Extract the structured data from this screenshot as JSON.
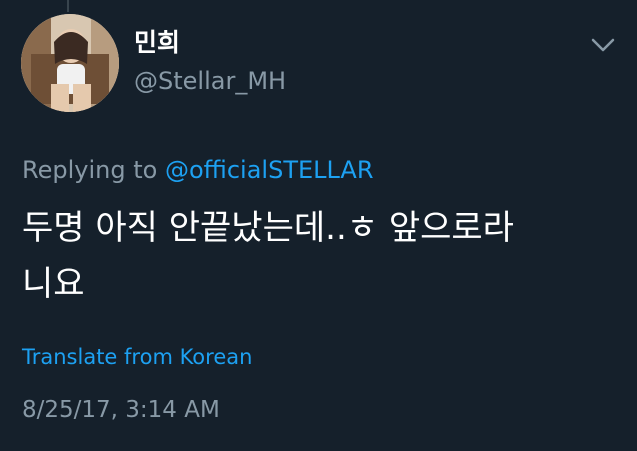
{
  "tweet": {
    "display_name": "민희",
    "handle": "@Stellar_MH",
    "replying_prefix": "Replying to",
    "replying_to": "@officialSTELLAR",
    "text_line1": "두명 아직 안끝났는데..ㅎ 앞으로라",
    "text_line2": "니요",
    "translate_label": "Translate from Korean",
    "timestamp": "8/25/17, 3:14 AM"
  },
  "icons": {
    "menu": "chevron-down-icon",
    "avatar": "profile-photo"
  },
  "colors": {
    "background": "#15202b",
    "accent": "#1da1f2",
    "secondary_text": "#8899a6",
    "primary_text": "#ffffff"
  }
}
